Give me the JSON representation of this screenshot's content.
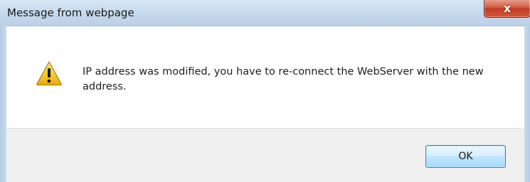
{
  "window": {
    "title": "Message from webpage",
    "close_label": "x"
  },
  "dialog": {
    "icon": "warning-icon",
    "message": "IP address was modified, you have to re-connect the WebServer with the new address."
  },
  "buttons": {
    "ok_label": "OK"
  },
  "colors": {
    "titlebar": "#c4d7ec",
    "content_bg": "#ffffff",
    "footer_bg": "#f0f0f0",
    "close_button": "#c23b22",
    "ok_button_border": "#3c7fb1",
    "warning_fill": "#f5c518"
  }
}
